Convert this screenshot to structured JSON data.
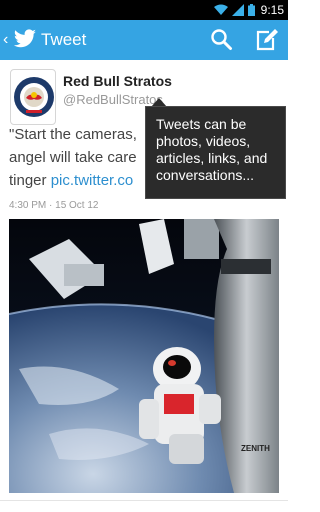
{
  "status_bar": {
    "time": "9:15"
  },
  "action_bar": {
    "title": "Tweet"
  },
  "tweet": {
    "user_name": "Red Bull Stratos",
    "handle": "@RedBullStratos",
    "line1": "\"Start the cameras,",
    "line2": "angel will take care",
    "line3_prefix": "tinger ",
    "link_text": "pic.twitter.co",
    "timestamp": "4:30 PM · 15 Oct 12"
  },
  "tooltip": {
    "text": "Tweets can be photos, videos, articles, links, and conversations..."
  },
  "photo": {
    "logo_text": "ZENITH"
  },
  "colors": {
    "action_bar": "#35a4e3",
    "link": "#2d8fcf",
    "tooltip_bg": "#2b2b2b"
  }
}
